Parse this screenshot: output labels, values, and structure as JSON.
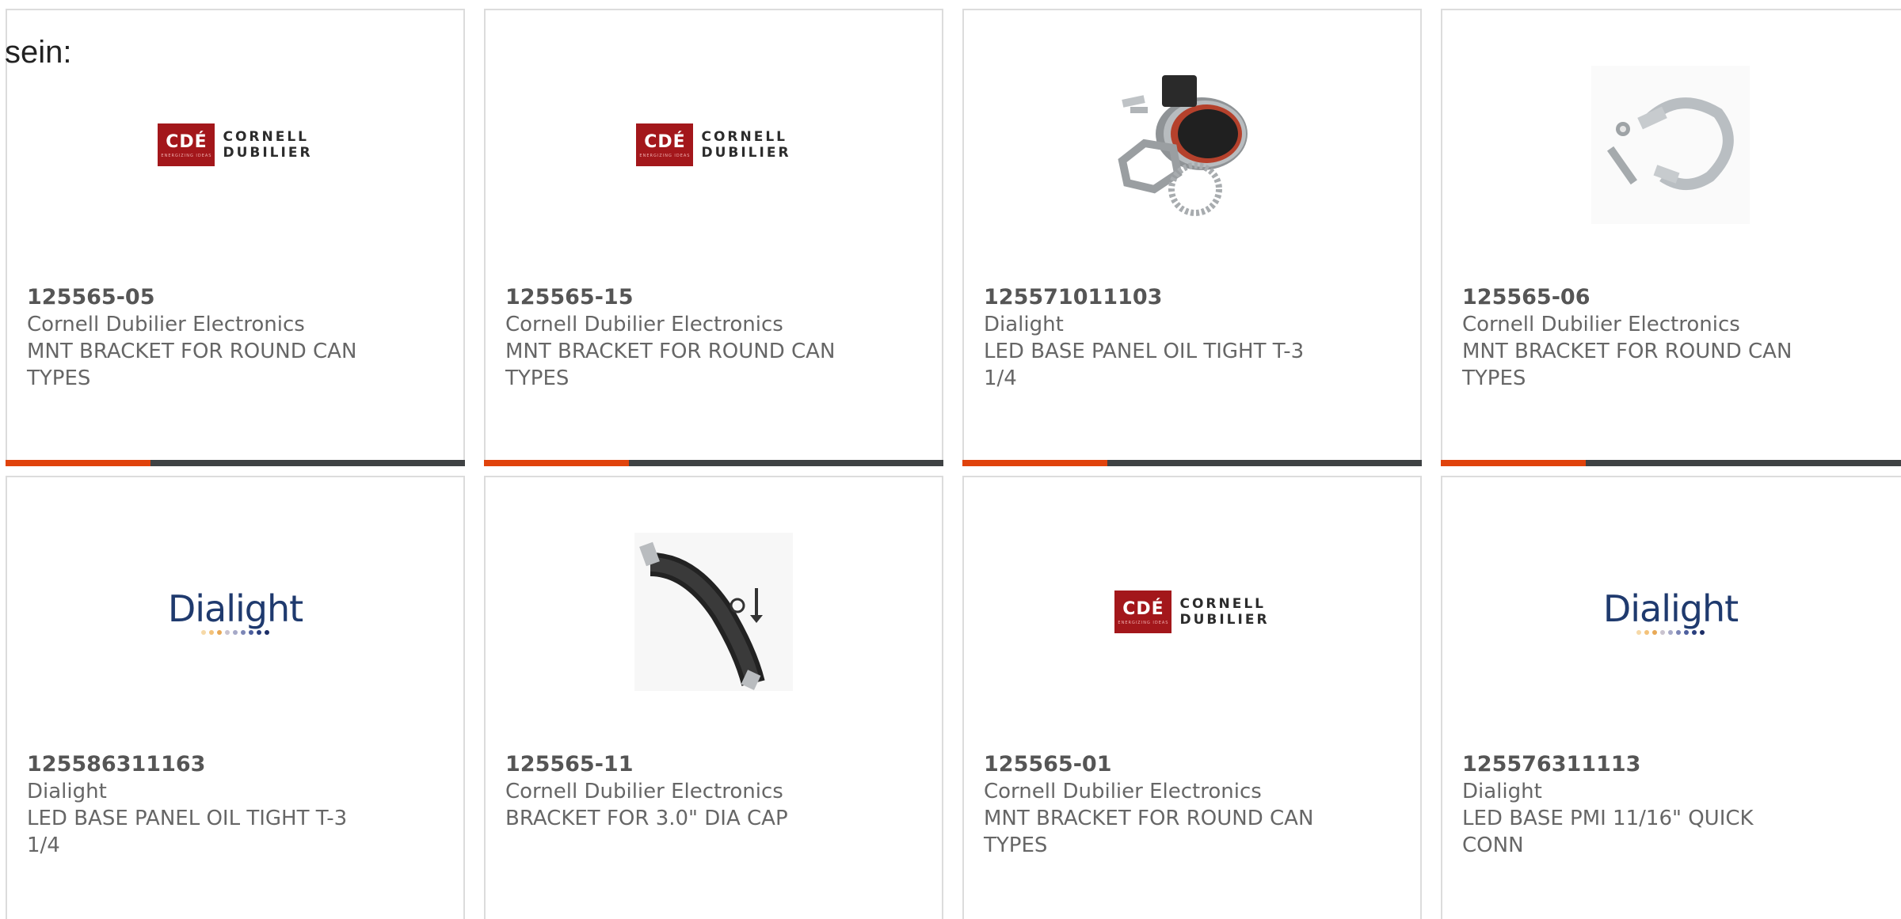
{
  "intro_text": "sein:",
  "logo_text": {
    "cde_mark": "CDÉ",
    "cde_tag": "ENERGIZING IDEAS",
    "cde_line1": "CORNELL",
    "cde_line2": "DUBILIER",
    "dialight": "Dialight"
  },
  "colors": {
    "accent": "#e0430c",
    "bar": "#3f4244",
    "cde_red": "#a3171b",
    "dialight_blue": "#1f3a6e"
  },
  "products": [
    {
      "part": "125565-05",
      "manufacturer": "Cornell Dubilier Electronics",
      "desc1": "MNT BRACKET FOR ROUND CAN",
      "desc2": "TYPES",
      "image": "cde-logo"
    },
    {
      "part": "125565-15",
      "manufacturer": "Cornell Dubilier Electronics",
      "desc1": "MNT BRACKET FOR ROUND CAN",
      "desc2": "TYPES",
      "image": "cde-logo"
    },
    {
      "part": "125571011103",
      "manufacturer": "Dialight",
      "desc1": "LED BASE PANEL OIL TIGHT T-3",
      "desc2": "1/4",
      "image": "led-panel-base-photo"
    },
    {
      "part": "125565-06",
      "manufacturer": "Cornell Dubilier Electronics",
      "desc1": "MNT BRACKET FOR ROUND CAN",
      "desc2": "TYPES",
      "image": "mounting-clamp-photo"
    },
    {
      "part": "125586311163",
      "manufacturer": "Dialight",
      "desc1": "LED BASE PANEL OIL TIGHT T-3",
      "desc2": "1/4",
      "image": "dialight-logo"
    },
    {
      "part": "125565-11",
      "manufacturer": "Cornell Dubilier Electronics",
      "desc1": "BRACKET FOR 3.0\" DIA CAP",
      "desc2": "",
      "image": "bracket-strap-photo"
    },
    {
      "part": "125565-01",
      "manufacturer": "Cornell Dubilier Electronics",
      "desc1": "MNT BRACKET FOR ROUND CAN",
      "desc2": "TYPES",
      "image": "cde-logo"
    },
    {
      "part": "125576311113",
      "manufacturer": "Dialight",
      "desc1": "LED BASE PMI 11/16\" QUICK",
      "desc2": "CONN",
      "image": "dialight-logo"
    }
  ]
}
